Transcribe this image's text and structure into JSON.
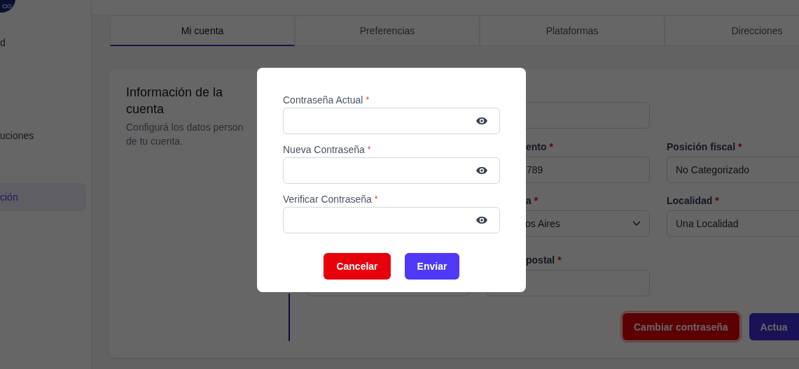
{
  "sidebar": {
    "items": [
      {
        "label": "d",
        "selected": false
      },
      {
        "label": "uciones",
        "selected": false
      },
      {
        "label": "ción",
        "selected": true
      }
    ]
  },
  "tabs": [
    {
      "label": "Mi cuenta",
      "selected": true
    },
    {
      "label": "Preferencias",
      "selected": false
    },
    {
      "label": "Plataformas",
      "selected": false
    },
    {
      "label": "Direcciones",
      "selected": false
    }
  ],
  "card": {
    "title": "Información de la cuenta",
    "description": "Configurá los datos person\nde tu cuenta.",
    "rows": [
      [
        {
          "kind": "blank"
        },
        {
          "kind": "input"
        },
        {
          "kind": "blank"
        }
      ],
      [
        {
          "kind": "blank"
        },
        {
          "kind": "input",
          "label": "ento",
          "required_mark": "*",
          "value": "789"
        },
        {
          "kind": "input",
          "label": "Posición fiscal",
          "required_mark": "*",
          "value": "No Categorizado"
        }
      ],
      [
        {
          "kind": "blank"
        },
        {
          "kind": "select",
          "label": "a",
          "required_mark": "*",
          "value": "os Aires"
        },
        {
          "kind": "input",
          "label": "Localidad",
          "required_mark": "*",
          "value": "Una Localidad"
        }
      ],
      [
        {
          "kind": "input"
        },
        {
          "kind": "input",
          "label": "postal",
          "required_mark": "*"
        },
        {
          "kind": "blank"
        }
      ]
    ],
    "buttons": [
      {
        "label": "Cambiar contraseña",
        "kind": "danger"
      },
      {
        "label": "Actua",
        "kind": "primary"
      }
    ]
  },
  "modal": {
    "fields": [
      {
        "label": "Contraseña Actual",
        "required_mark": "*"
      },
      {
        "label": "Nueva Contraseña",
        "required_mark": "*"
      },
      {
        "label": "Verificar Contraseña",
        "required_mark": "*"
      }
    ],
    "buttons": [
      {
        "label": "Cancelar",
        "kind": "cancel"
      },
      {
        "label": "Enviar",
        "kind": "submit"
      }
    ]
  }
}
